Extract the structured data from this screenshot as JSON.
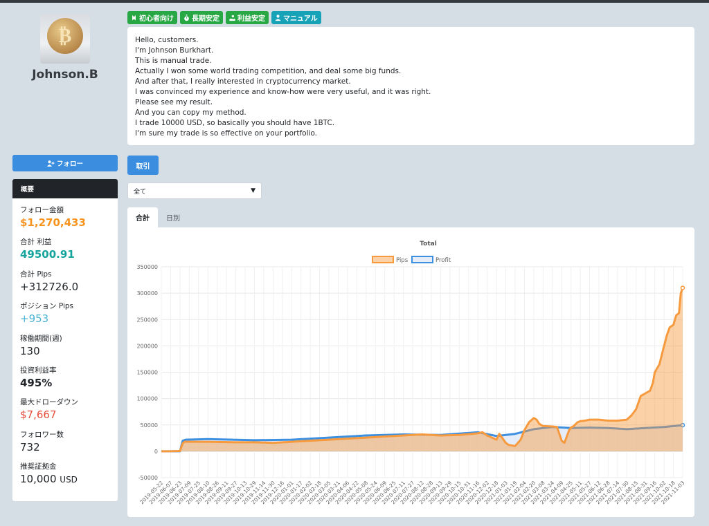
{
  "profile": {
    "name": "Johnson.B",
    "avatar_icon": "bitcoin-coin-icon"
  },
  "tags": [
    {
      "label": "初心者向け",
      "icon": "beginner-icon",
      "color": "#28a745"
    },
    {
      "label": "長期安定",
      "icon": "stopwatch-icon",
      "color": "#28a745"
    },
    {
      "label": "利益安定",
      "icon": "hand-coin-icon",
      "color": "#28a745"
    },
    {
      "label": "マニュアル",
      "icon": "user-icon",
      "color": "#17a2b8"
    }
  ],
  "description": [
    "Hello, customers.",
    "I'm Johnson Burkhart.",
    "This is manual trade.",
    "Actually I won some world trading competition, and deal some big funds.",
    "And after that, I really interested in cryptocurrency market.",
    "I was convinced my experience and know-how were very useful, and it was right.",
    "Please see my result.",
    "And you can copy my method.",
    "I trade 10000 USD, so basically you should have 1BTC.",
    "I'm sure my trade is so effective on your portfolio."
  ],
  "follow_button": "フォロー",
  "summary": {
    "title": "概要",
    "stats": [
      {
        "label": "フォロー金額",
        "value": "$1,270,433"
      },
      {
        "label": "合計 利益",
        "value": "49500.91"
      },
      {
        "label": "合計 Pips",
        "value": "+312726.0"
      },
      {
        "label": "ポジション Pips",
        "value": "+953"
      },
      {
        "label": "稼働期間(週)",
        "value": "130"
      },
      {
        "label": "投資利益率",
        "value": "495%"
      },
      {
        "label": "最大ドローダウン",
        "value": "$7,667"
      },
      {
        "label": "フォロワー数",
        "value": "732"
      },
      {
        "label": "推奨証拠金",
        "value": "10,000",
        "unit": "USD"
      }
    ]
  },
  "trade_button": "取引",
  "filter_select": {
    "selected": "全て"
  },
  "tabs": [
    {
      "label": "合計",
      "active": true
    },
    {
      "label": "日別",
      "active": false
    }
  ],
  "chart_data": {
    "type": "area",
    "title": "Total",
    "legend_position": "top",
    "grid": true,
    "ylim": [
      -50000,
      350000
    ],
    "yticks": [
      350000,
      300000,
      250000,
      200000,
      150000,
      100000,
      50000,
      0,
      -50000
    ],
    "xlabels": [
      "2019-05-22",
      "2019-06-07",
      "2019-06-23",
      "2019-07-09",
      "2019-07-25",
      "2019-08-10",
      "2019-08-26",
      "2019-09-11",
      "2019-09-27",
      "2019-10-13",
      "2019-10-29",
      "2019-11-14",
      "2019-11-30",
      "2019-12-16",
      "2020-01-01",
      "2020-01-17",
      "2020-02-02",
      "2020-02-18",
      "2020-03-05",
      "2020-03-21",
      "2020-04-06",
      "2020-04-22",
      "2020-05-08",
      "2020-05-24",
      "2020-06-09",
      "2020-06-25",
      "2020-07-11",
      "2020-07-27",
      "2020-08-12",
      "2020-08-28",
      "2020-09-13",
      "2020-09-29",
      "2020-10-15",
      "2020-10-31",
      "2020-11-16",
      "2020-12-02",
      "2020-12-18",
      "2021-01-03",
      "2021-01-19",
      "2021-02-04",
      "2021-02-20",
      "2021-03-08",
      "2021-03-24",
      "2021-04-09",
      "2021-04-25",
      "2021-05-11",
      "2021-05-27",
      "2021-06-12",
      "2021-06-28",
      "2021-07-14",
      "2021-07-30",
      "2021-08-15",
      "2021-08-31",
      "2021-09-16",
      "2021-10-02",
      "2021-10-18",
      "2021-11-03"
    ],
    "series": [
      {
        "name": "Pips",
        "color": "#f79a3e",
        "fill": "rgba(247,154,62,0.45)",
        "x": [
          0,
          1,
          2,
          2.3,
          2.5,
          3,
          5,
          8,
          10,
          12,
          14,
          16,
          18,
          20,
          22,
          24,
          26,
          28,
          30,
          32,
          34,
          34.5,
          35,
          36,
          36.3,
          36.6,
          37,
          37.3,
          38,
          38.6,
          39,
          39.5,
          40,
          40.3,
          40.6,
          40.8,
          41,
          42,
          42.5,
          43,
          43.3,
          43.8,
          44,
          44.3,
          44.7,
          45,
          45.5,
          46,
          47,
          48,
          49,
          50,
          50.5,
          51,
          51.5,
          52,
          52.5,
          52.8,
          53,
          53.5,
          54,
          54.3,
          54.6,
          55,
          55.3,
          55.6,
          55.8,
          56
        ],
        "values": [
          0,
          0,
          500,
          15000,
          18000,
          18000,
          18000,
          17000,
          17000,
          16000,
          18000,
          20000,
          22000,
          24000,
          26000,
          28000,
          30000,
          32000,
          30000,
          31000,
          34000,
          36000,
          30000,
          22000,
          33000,
          26000,
          16000,
          12000,
          10000,
          22000,
          40000,
          55000,
          63000,
          60000,
          52000,
          50000,
          48000,
          47000,
          46000,
          20000,
          16000,
          40000,
          45000,
          48000,
          55000,
          57000,
          58000,
          60000,
          60000,
          58000,
          58000,
          60000,
          68000,
          80000,
          105000,
          110000,
          115000,
          130000,
          150000,
          165000,
          200000,
          220000,
          235000,
          240000,
          258000,
          262000,
          300000,
          310000
        ]
      },
      {
        "name": "Profit",
        "color": "#3d8fe0",
        "fill": "rgba(220,228,245,0.7)",
        "x": [
          0,
          2,
          2.3,
          2.6,
          5,
          10,
          14,
          18,
          22,
          26,
          30,
          34,
          36,
          38,
          40,
          42,
          44,
          46,
          48,
          50,
          52,
          54,
          56
        ],
        "values": [
          0,
          0,
          20000,
          22000,
          23000,
          21000,
          22000,
          26000,
          30000,
          32000,
          31000,
          36000,
          29000,
          33000,
          42000,
          46000,
          44000,
          45000,
          44000,
          42000,
          44000,
          46000,
          49500
        ]
      }
    ]
  }
}
